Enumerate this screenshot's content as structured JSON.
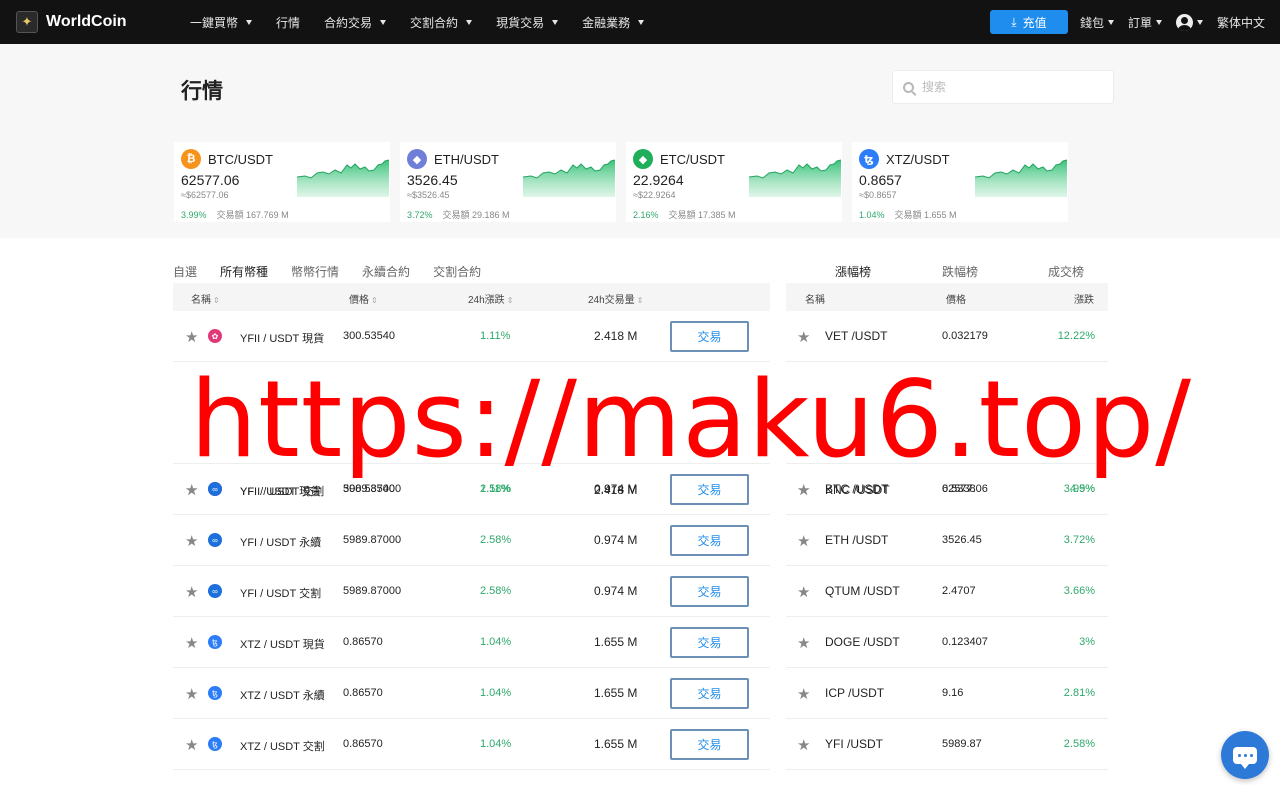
{
  "nav": {
    "logo_text": "WorldCoin",
    "menu": [
      {
        "label": "一鍵買幣",
        "has_caret": true
      },
      {
        "label": "行情",
        "has_caret": false
      },
      {
        "label": "合約交易",
        "has_caret": true
      },
      {
        "label": "交割合約",
        "has_caret": true
      },
      {
        "label": "現貨交易",
        "has_caret": true
      },
      {
        "label": "金融業務",
        "has_caret": true
      }
    ],
    "deposit_label": "充值",
    "wallet_label": "錢包",
    "orders_label": "訂單",
    "language_label": "繁体中文",
    "icons": {
      "deposit": "download-icon",
      "user": "user-avatar-icon"
    },
    "accent_color": "#1f8ded"
  },
  "hero": {
    "page_title": "行情",
    "search_placeholder": "搜索",
    "cards": [
      {
        "pair": "BTC/USDT",
        "price": "62577.06",
        "approx": "≈$62577.06",
        "change": "3.99%",
        "volume_label": "交易額 167.769 M",
        "icon": "bitcoin-icon",
        "icon_color": "#f7931a",
        "icon_glyph": "₿"
      },
      {
        "pair": "ETH/USDT",
        "price": "3526.45",
        "approx": "≈$3526.45",
        "change": "3.72%",
        "volume_label": "交易額 29.186 M",
        "icon": "ethereum-icon",
        "icon_color": "#6f7fd8",
        "icon_glyph": "◆"
      },
      {
        "pair": "ETC/USDT",
        "price": "22.9264",
        "approx": "≈$22.9264",
        "change": "2.16%",
        "volume_label": "交易額 17.385 M",
        "icon": "ethereum-classic-icon",
        "icon_color": "#1fae5a",
        "icon_glyph": "◆"
      },
      {
        "pair": "XTZ/USDT",
        "price": "0.8657",
        "approx": "≈$0.8657",
        "change": "1.04%",
        "volume_label": "交易額 1.655 M",
        "icon": "tezos-icon",
        "icon_color": "#2c7df7",
        "icon_glyph": "ꜩ"
      }
    ]
  },
  "market_table": {
    "tabs": [
      "自選",
      "所有幣種",
      "幣幣行情",
      "永續合約",
      "交割合約"
    ],
    "active_tab": 1,
    "headers": {
      "name": "名稱",
      "price": "價格",
      "change": "24h漲跌",
      "volume": "24h交易量"
    },
    "trade_label": "交易",
    "rows": [
      {
        "name": "YFII / USDT 現貨",
        "price": "300.53540",
        "change": "1.11%",
        "volume": "2.418 M",
        "icon": "yfii-icon",
        "icon_color": "#e2387a",
        "icon_glyph": "✿"
      },
      {
        "name": "YFII / USDT 交割",
        "price": "300.53540",
        "change": "1.11%",
        "volume": "2.418 M",
        "icon": "yfii-icon",
        "icon_color": "#e2387a",
        "icon_glyph": "✿"
      },
      {
        "name": "YFI / USDT 現貨",
        "price": "5989.87000",
        "change": "2.58%",
        "volume": "0.974 M",
        "icon": "yfi-icon",
        "icon_color": "#1d6fdc",
        "icon_glyph": "∞"
      },
      {
        "name": "YFI / USDT 永續",
        "price": "5989.87000",
        "change": "2.58%",
        "volume": "0.974 M",
        "icon": "yfi-icon",
        "icon_color": "#1d6fdc",
        "icon_glyph": "∞"
      },
      {
        "name": "YFI / USDT 交割",
        "price": "5989.87000",
        "change": "2.58%",
        "volume": "0.974 M",
        "icon": "yfi-icon",
        "icon_color": "#1d6fdc",
        "icon_glyph": "∞"
      },
      {
        "name": "XTZ / USDT 現貨",
        "price": "0.86570",
        "change": "1.04%",
        "volume": "1.655 M",
        "icon": "tezos-icon",
        "icon_color": "#2c7df7",
        "icon_glyph": "ꜩ"
      },
      {
        "name": "XTZ / USDT 永續",
        "price": "0.86570",
        "change": "1.04%",
        "volume": "1.655 M",
        "icon": "tezos-icon",
        "icon_color": "#2c7df7",
        "icon_glyph": "ꜩ"
      },
      {
        "name": "XTZ / USDT 交割",
        "price": "0.86570",
        "change": "1.04%",
        "volume": "1.655 M",
        "icon": "tezos-icon",
        "icon_color": "#2c7df7",
        "icon_glyph": "ꜩ"
      }
    ]
  },
  "ranking": {
    "tabs": [
      "漲幅榜",
      "跌幅榜",
      "成交榜"
    ],
    "active_tab": 0,
    "headers": {
      "name": "名稱",
      "price": "價格",
      "change": "漲跌"
    },
    "rows": [
      {
        "name": "VET /USDT",
        "price": "0.032179",
        "change": "12.22%"
      },
      {
        "name": "KNC /USDT",
        "price": "0.5338",
        "change": "4.5%"
      },
      {
        "name": "BTC /USDT",
        "price": "62577.06",
        "change": "3.99%"
      },
      {
        "name": "ETH /USDT",
        "price": "3526.45",
        "change": "3.72%"
      },
      {
        "name": "QTUM /USDT",
        "price": "2.4707",
        "change": "3.66%"
      },
      {
        "name": "DOGE /USDT",
        "price": "0.123407",
        "change": "3%"
      },
      {
        "name": "ICP /USDT",
        "price": "9.16",
        "change": "2.81%"
      },
      {
        "name": "YFI /USDT",
        "price": "5989.87",
        "change": "2.58%"
      }
    ]
  },
  "watermark": "https://maku6.top/",
  "chat": {
    "icon": "chat-icon",
    "color": "#2c79d8"
  },
  "colors": {
    "up": "#2fa96b",
    "nav_bg": "#121212"
  }
}
